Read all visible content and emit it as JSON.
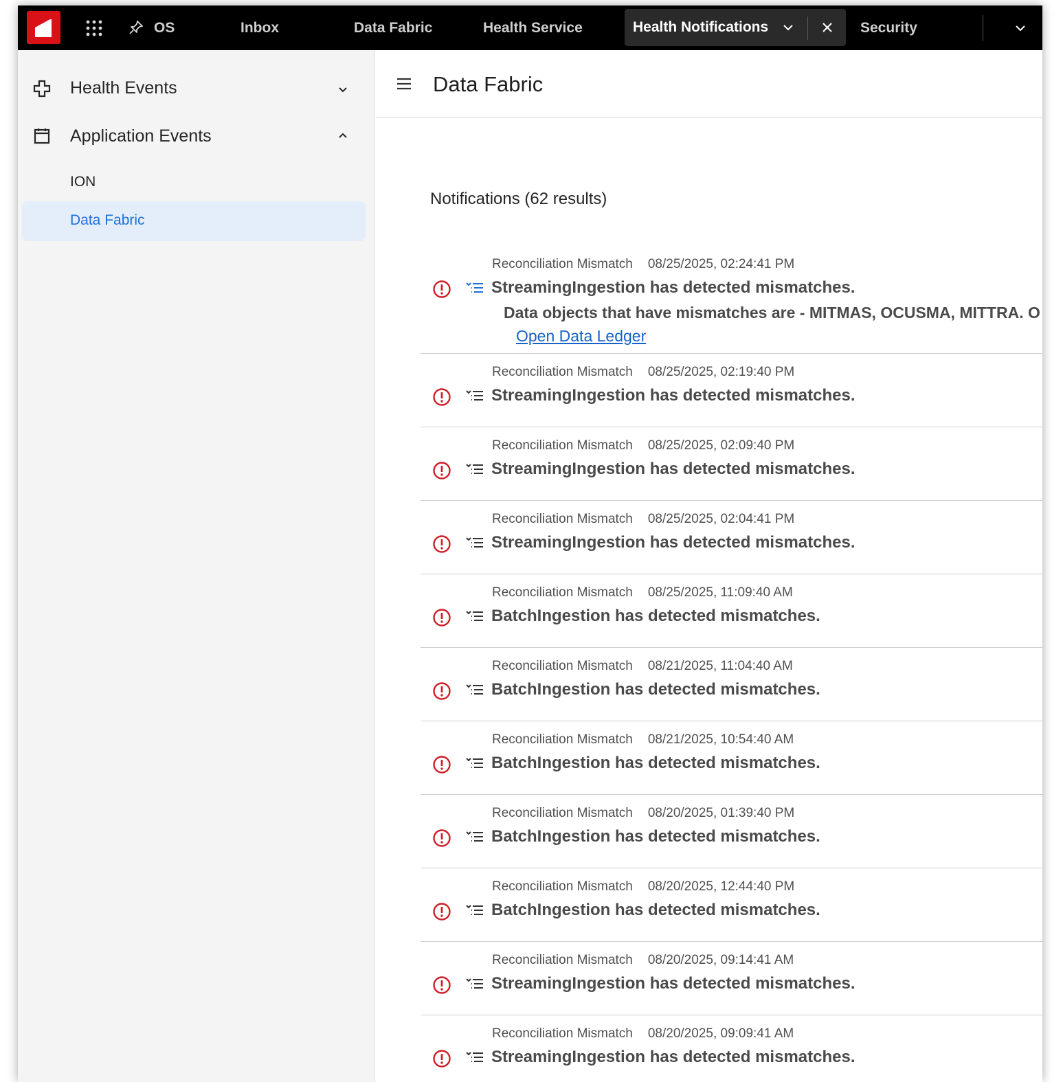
{
  "topbar": {
    "tabs": [
      {
        "label": "OS"
      },
      {
        "label": "Inbox"
      },
      {
        "label": "Data Fabric"
      },
      {
        "label": "Health Service"
      },
      {
        "label": "Health Notifications",
        "active": true
      },
      {
        "label": "Security"
      }
    ],
    "icons": [
      "app-logo",
      "apps-grid-icon",
      "pin-icon",
      "chevron-down-icon",
      "close-icon",
      "chevron-down-icon"
    ]
  },
  "sidebar": {
    "groups": [
      {
        "label": "Health Events",
        "icon": "health-cross-icon",
        "expanded": false
      },
      {
        "label": "Application Events",
        "icon": "calendar-icon",
        "expanded": true,
        "items": [
          {
            "label": "ION"
          },
          {
            "label": "Data Fabric",
            "selected": true
          }
        ]
      }
    ]
  },
  "main": {
    "title": "Data Fabric",
    "results_heading": "Notifications (62 results)",
    "notifications": [
      {
        "type": "Reconciliation Mismatch",
        "date": "08/25/2025, 02:24:41 PM",
        "message": "StreamingIngestion has detected mismatches.",
        "detail": "Data objects that have mismatches are - MITMAS, OCUSMA, MITTRA. O",
        "link": "Open Data Ledger"
      },
      {
        "type": "Reconciliation Mismatch",
        "date": "08/25/2025, 02:19:40 PM",
        "message": "StreamingIngestion has detected mismatches."
      },
      {
        "type": "Reconciliation Mismatch",
        "date": "08/25/2025, 02:09:40 PM",
        "message": "StreamingIngestion has detected mismatches."
      },
      {
        "type": "Reconciliation Mismatch",
        "date": "08/25/2025, 02:04:41 PM",
        "message": "StreamingIngestion has detected mismatches."
      },
      {
        "type": "Reconciliation Mismatch",
        "date": "08/25/2025, 11:09:40 AM",
        "message": "BatchIngestion has detected mismatches."
      },
      {
        "type": "Reconciliation Mismatch",
        "date": "08/21/2025, 11:04:40 AM",
        "message": "BatchIngestion has detected mismatches."
      },
      {
        "type": "Reconciliation Mismatch",
        "date": "08/21/2025, 10:54:40 AM",
        "message": "BatchIngestion has detected mismatches."
      },
      {
        "type": "Reconciliation Mismatch",
        "date": "08/20/2025, 01:39:40 PM",
        "message": "BatchIngestion has detected mismatches."
      },
      {
        "type": "Reconciliation Mismatch",
        "date": "08/20/2025, 12:44:40 PM",
        "message": "BatchIngestion has detected mismatches."
      },
      {
        "type": "Reconciliation Mismatch",
        "date": "08/20/2025, 09:14:41 AM",
        "message": "StreamingIngestion has detected mismatches."
      },
      {
        "type": "Reconciliation Mismatch",
        "date": "08/20/2025, 09:09:41 AM",
        "message": "StreamingIngestion has detected mismatches."
      }
    ]
  },
  "colors": {
    "brand_red": "#da1217",
    "topbar_bg": "#000000",
    "active_tab_bg": "#2a2a2a",
    "sidebar_bg": "#f4f4f4",
    "selected_bg": "#e4eefb",
    "selected_text": "#1d70d8",
    "alert_red": "#d0202a",
    "tree_icon_blue": "#1d70d8",
    "link_blue": "#1564c8"
  }
}
